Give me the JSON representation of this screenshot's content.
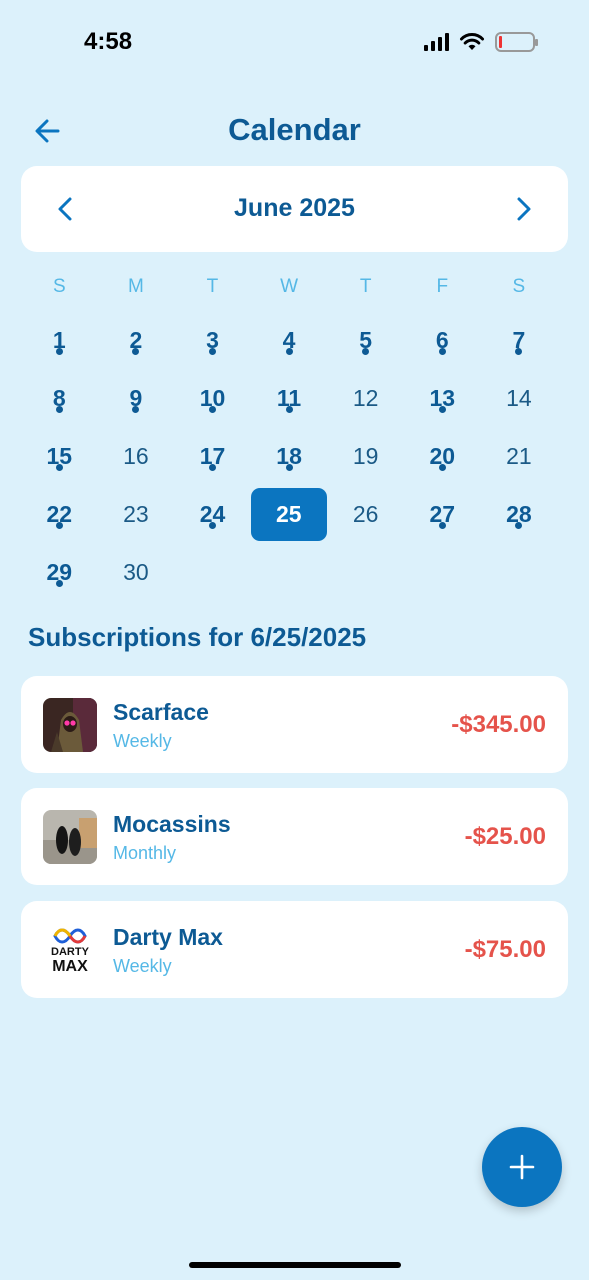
{
  "status": {
    "time": "4:58"
  },
  "header": {
    "title": "Calendar"
  },
  "calendar": {
    "month_label": "June 2025",
    "weekdays": [
      "S",
      "M",
      "T",
      "W",
      "T",
      "F",
      "S"
    ],
    "days": [
      {
        "n": "1",
        "has": true
      },
      {
        "n": "2",
        "has": true
      },
      {
        "n": "3",
        "has": true
      },
      {
        "n": "4",
        "has": true
      },
      {
        "n": "5",
        "has": true
      },
      {
        "n": "6",
        "has": true
      },
      {
        "n": "7",
        "has": true
      },
      {
        "n": "8",
        "has": true
      },
      {
        "n": "9",
        "has": true
      },
      {
        "n": "10",
        "has": true
      },
      {
        "n": "11",
        "has": true
      },
      {
        "n": "12",
        "has": false
      },
      {
        "n": "13",
        "has": true
      },
      {
        "n": "14",
        "has": false
      },
      {
        "n": "15",
        "has": true
      },
      {
        "n": "16",
        "has": false
      },
      {
        "n": "17",
        "has": true
      },
      {
        "n": "18",
        "has": true
      },
      {
        "n": "19",
        "has": false
      },
      {
        "n": "20",
        "has": true
      },
      {
        "n": "21",
        "has": false
      },
      {
        "n": "22",
        "has": true
      },
      {
        "n": "23",
        "has": false
      },
      {
        "n": "24",
        "has": true
      },
      {
        "n": "25",
        "has": true,
        "selected": true
      },
      {
        "n": "26",
        "has": false
      },
      {
        "n": "27",
        "has": true
      },
      {
        "n": "28",
        "has": true
      },
      {
        "n": "29",
        "has": true
      },
      {
        "n": "30",
        "has": false
      }
    ]
  },
  "subscriptions": {
    "title": "Subscriptions for 6/25/2025",
    "items": [
      {
        "name": "Scarface",
        "frequency": "Weekly",
        "amount": "-$345.00",
        "icon": "poster-image"
      },
      {
        "name": "Mocassins",
        "frequency": "Monthly",
        "amount": "-$25.00",
        "icon": "shoes-image"
      },
      {
        "name": "Darty Max",
        "frequency": "Weekly",
        "amount": "-$75.00",
        "icon": "darty-max-logo",
        "logo_text": [
          "DARTY",
          "MAX"
        ]
      }
    ]
  },
  "colors": {
    "background": "#dcf1fb",
    "primary": "#0d5a94",
    "accent": "#0b75c0",
    "light_text": "#55b8e6",
    "amount": "#e5534b"
  }
}
